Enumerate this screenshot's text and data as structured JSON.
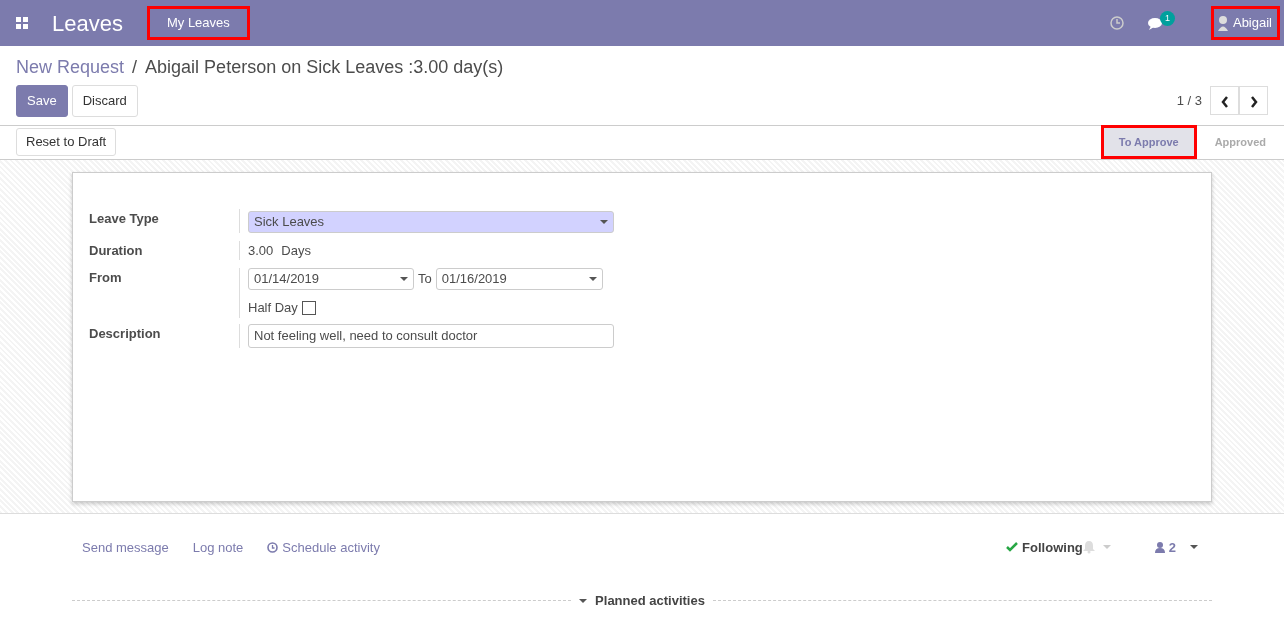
{
  "navbar": {
    "app_title": "Leaves",
    "menu": [
      {
        "label": "My Leaves",
        "highlighted": true
      }
    ],
    "messages_badge": "1",
    "user": {
      "name": "Abigail",
      "highlighted": true
    }
  },
  "breadcrumb_separator": "/",
  "breadcrumb": [
    {
      "label": "New Request",
      "link": true
    },
    {
      "label": "Abigail Peterson on Sick Leaves :3.00 day(s)",
      "link": false
    }
  ],
  "buttons": [
    "Save",
    "Discard"
  ],
  "pager": "1 / 3",
  "header_buttons": [
    "Reset to Draft"
  ],
  "stages": [
    {
      "label": "To Approve",
      "selected": true,
      "highlighted": true
    },
    {
      "label": "Approved",
      "selected": false,
      "highlighted": false
    }
  ],
  "form": {
    "leave_type": {
      "label": "Leave Type",
      "value": "Sick Leaves"
    },
    "duration": {
      "label": "Duration",
      "value": "3.00",
      "unit": "Days"
    },
    "from": {
      "label": "From",
      "value": "01/14/2019",
      "to_label": "To",
      "to_value": "01/16/2019"
    },
    "half_day": {
      "label": "Half Day",
      "checked": false
    },
    "description": {
      "label": "Description",
      "value": "Not feeling well, need to consult doctor"
    }
  },
  "chatter": {
    "actions": [
      "Send message",
      "Log note",
      "Schedule activity"
    ],
    "following": "Following",
    "followers": "2",
    "planned": "Planned activities"
  }
}
